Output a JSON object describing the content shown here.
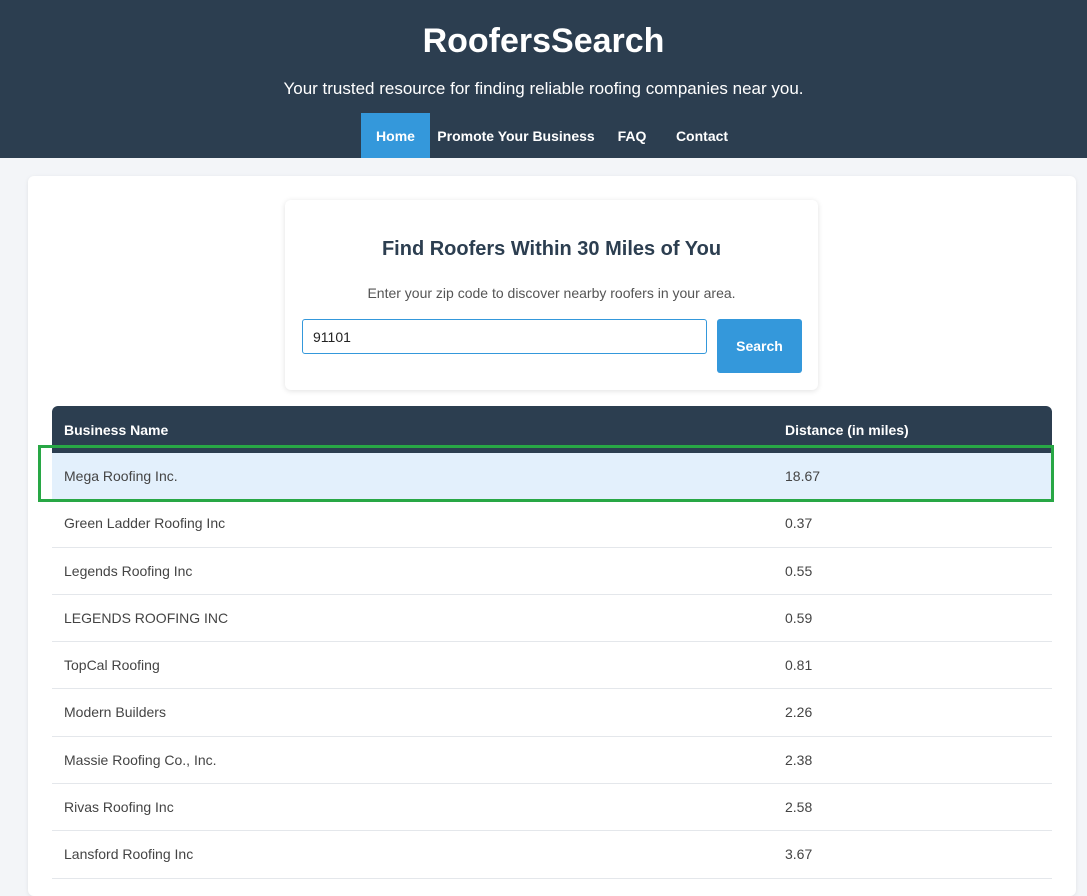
{
  "header": {
    "title": "RoofersSearch",
    "tagline": "Your trusted resource for finding reliable roofing companies near you."
  },
  "nav": {
    "items": [
      {
        "label": "Home",
        "active": true
      },
      {
        "label": "Promote Your Business",
        "active": false
      },
      {
        "label": "FAQ",
        "active": false
      },
      {
        "label": "Contact",
        "active": false
      }
    ]
  },
  "search": {
    "title": "Find Roofers Within 30 Miles of You",
    "description": "Enter your zip code to discover nearby roofers in your area.",
    "zip_value": "91101",
    "button_label": "Search"
  },
  "results": {
    "columns": [
      "Business Name",
      "Distance (in miles)"
    ],
    "rows": [
      {
        "name": "Mega Roofing Inc.",
        "distance": "18.67",
        "highlighted": true
      },
      {
        "name": "Green Ladder Roofing Inc",
        "distance": "0.37"
      },
      {
        "name": "Legends Roofing Inc",
        "distance": "0.55"
      },
      {
        "name": "LEGENDS ROOFING INC",
        "distance": "0.59"
      },
      {
        "name": "TopCal Roofing",
        "distance": "0.81"
      },
      {
        "name": "Modern Builders",
        "distance": "2.26"
      },
      {
        "name": "Massie Roofing Co., Inc.",
        "distance": "2.38"
      },
      {
        "name": "Rivas Roofing Inc",
        "distance": "2.58"
      },
      {
        "name": "Lansford Roofing Inc",
        "distance": "3.67"
      }
    ]
  },
  "colors": {
    "header_bg": "#2c3e50",
    "accent": "#3498db",
    "highlight_row": "#e3f0fc",
    "highlight_outline": "#28a745"
  }
}
